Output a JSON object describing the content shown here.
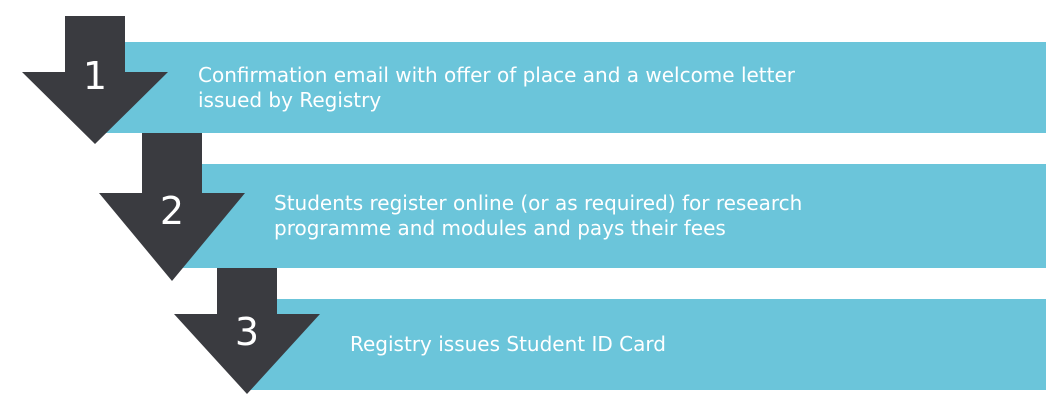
{
  "colors": {
    "bar": "#6bc5da",
    "arrow": "#3a3b40",
    "text": "#ffffff"
  },
  "steps": [
    {
      "number": "1",
      "text_line1": "Confirmation email with offer of place and a welcome letter",
      "text_line2": "issued by Registry"
    },
    {
      "number": "2",
      "text_line1": "Students register online (or as required) for research",
      "text_line2": "programme and modules and pays their fees"
    },
    {
      "number": "3",
      "text_line1": "Registry issues Student ID Card",
      "text_line2": ""
    }
  ]
}
